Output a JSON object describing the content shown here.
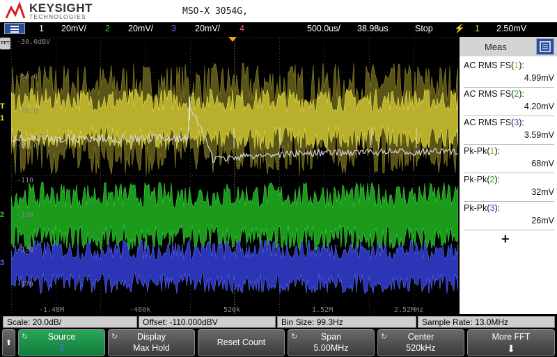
{
  "header": {
    "brand": "KEYSIGHT",
    "brand_sub": "TECHNOLOGIES",
    "model": "MSO-X 3054G,"
  },
  "status_bar": {
    "ch1_num": "1",
    "ch1_scale": "20mV/",
    "ch2_num": "2",
    "ch2_scale": "20mV/",
    "ch3_num": "3",
    "ch3_scale": "20mV/",
    "ch4_num": "4",
    "timebase": "500.0us/",
    "delay": "38.98us",
    "run_state": "Stop",
    "trig_channel": "1",
    "trig_level": "2.50mV",
    "colors": {
      "ch1": "#e8e04a",
      "ch2": "#3ad63a",
      "ch3": "#5a6cff",
      "ch4": "#ff3fb0",
      "trigger": "#f4c21c"
    }
  },
  "plot": {
    "fft_tab": "FFT",
    "y_labels": [
      "-30.0dBV",
      "-50.0",
      "-70.0",
      "-90.0",
      "-110",
      "-130",
      "-150",
      "-170"
    ],
    "x_labels": [
      "-1.48M",
      "-480k",
      "520k",
      "1.52M",
      "2.52MHz"
    ],
    "ch1_marker": "1",
    "ch2_marker": "2",
    "ch3_marker": "3",
    "trig_marker": "T"
  },
  "meas_panel": {
    "title": "Meas",
    "items": [
      {
        "pre": "AC RMS FS(",
        "ch": "1",
        "post": "):",
        "value": "4.99mV"
      },
      {
        "pre": "AC RMS FS(",
        "ch": "2",
        "post": "):",
        "value": "4.20mV"
      },
      {
        "pre": "AC RMS FS(",
        "ch": "3",
        "post": "):",
        "value": "3.59mV"
      },
      {
        "pre": "Pk-Pk(",
        "ch": "1",
        "post": "):",
        "value": "68mV"
      },
      {
        "pre": "Pk-Pk(",
        "ch": "2",
        "post": "):",
        "value": "32mV"
      },
      {
        "pre": "Pk-Pk(",
        "ch": "3",
        "post": "):",
        "value": "26mV"
      }
    ],
    "add_label": "+"
  },
  "info_bar": {
    "scale": "Scale: 20.0dB/",
    "offset": "Offset: -110.000dBV",
    "bin_size": "Bin Size: 99.3Hz",
    "sample_rate": "Sample Rate: 13.0MHz"
  },
  "softkeys": {
    "source_label": "Source",
    "source_value": "3",
    "display_label": "Display",
    "display_value": "Max Hold",
    "reset_label": "Reset Count",
    "span_label": "Span",
    "span_value": "5.00MHz",
    "center_label": "Center",
    "center_value": "520kHz",
    "more_label": "More FFT"
  }
}
